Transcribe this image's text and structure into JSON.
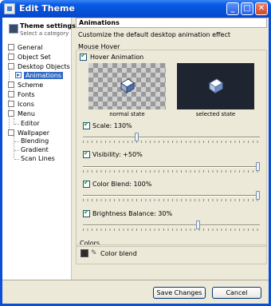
{
  "window": {
    "title": "Edit Theme",
    "minimize_glyph": "_",
    "maximize_glyph": "□",
    "close_glyph": "✕"
  },
  "sidebar": {
    "heading": "Theme settings",
    "subheading": "Select a category",
    "items": [
      {
        "label": "General"
      },
      {
        "label": "Object Set"
      },
      {
        "label": "Desktop Objects"
      },
      {
        "label": "Animations"
      },
      {
        "label": "Scheme"
      },
      {
        "label": "Fonts"
      },
      {
        "label": "Icons"
      },
      {
        "label": "Menu"
      },
      {
        "label": "Editor"
      },
      {
        "label": "Wallpaper"
      },
      {
        "label": "Blending"
      },
      {
        "label": "Gradient"
      },
      {
        "label": "Scan Lines"
      }
    ],
    "selected": "Animations"
  },
  "main": {
    "header": "Animations",
    "description": "Customize the default desktop animation effect",
    "mouse_hover": {
      "group_label": "Mouse Hover",
      "hover_animation": {
        "label": "Hover Animation",
        "checked": true
      },
      "normal_caption": "normal state",
      "selected_caption": "selected state",
      "scale": {
        "label": "Scale: 130%",
        "checked": true,
        "value_percent": 130,
        "position": 0.3
      },
      "visibility": {
        "label": "Visibility: +50%",
        "checked": true,
        "value_percent": 50,
        "position": 1.0
      },
      "color_blend": {
        "label": "Color Blend: 100%",
        "checked": true,
        "value_percent": 100,
        "position": 1.0
      },
      "brightness": {
        "label": "Brightness Balance: 30%",
        "checked": true,
        "value_percent": 30,
        "position": 0.65
      }
    },
    "colors": {
      "group_label": "Colors",
      "color_blend_label": "Color blend",
      "swatch_color": "#2d2d2d"
    }
  },
  "footer": {
    "save_label": "Save Changes",
    "cancel_label": "Cancel"
  }
}
